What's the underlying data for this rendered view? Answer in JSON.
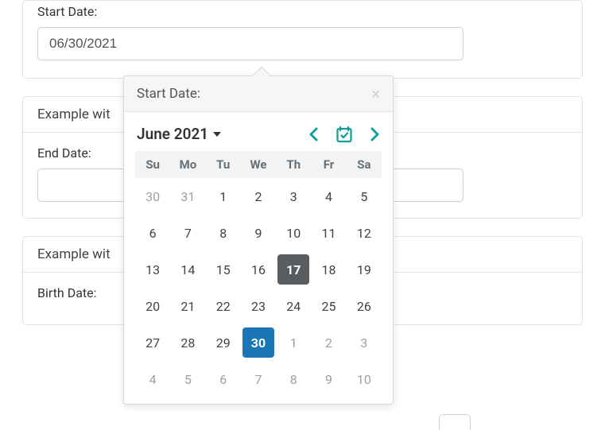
{
  "field1": {
    "label": "Start Date:",
    "value": "06/30/2021"
  },
  "card2": {
    "header": "Example wit",
    "field": {
      "label": "End Date:",
      "value": ""
    }
  },
  "card3": {
    "header": "Example wit",
    "field": {
      "label": "Birth Date:",
      "value": ""
    }
  },
  "datepicker": {
    "title": "Start Date:",
    "month_label": "June 2021",
    "weekdays": [
      "Su",
      "Mo",
      "Tu",
      "We",
      "Th",
      "Fr",
      "Sa"
    ],
    "weeks": [
      [
        {
          "d": "30",
          "muted": true
        },
        {
          "d": "31",
          "muted": true
        },
        {
          "d": "1"
        },
        {
          "d": "2"
        },
        {
          "d": "3"
        },
        {
          "d": "4"
        },
        {
          "d": "5"
        }
      ],
      [
        {
          "d": "6"
        },
        {
          "d": "7"
        },
        {
          "d": "8"
        },
        {
          "d": "9"
        },
        {
          "d": "10"
        },
        {
          "d": "11"
        },
        {
          "d": "12"
        }
      ],
      [
        {
          "d": "13"
        },
        {
          "d": "14"
        },
        {
          "d": "15"
        },
        {
          "d": "16"
        },
        {
          "d": "17",
          "today": true
        },
        {
          "d": "18"
        },
        {
          "d": "19"
        }
      ],
      [
        {
          "d": "20"
        },
        {
          "d": "21"
        },
        {
          "d": "22"
        },
        {
          "d": "23"
        },
        {
          "d": "24"
        },
        {
          "d": "25"
        },
        {
          "d": "26"
        }
      ],
      [
        {
          "d": "27"
        },
        {
          "d": "28"
        },
        {
          "d": "29"
        },
        {
          "d": "30",
          "selected": true
        },
        {
          "d": "1",
          "muted": true
        },
        {
          "d": "2",
          "muted": true
        },
        {
          "d": "3",
          "muted": true
        }
      ],
      [
        {
          "d": "4",
          "muted": true
        },
        {
          "d": "5",
          "muted": true
        },
        {
          "d": "6",
          "muted": true
        },
        {
          "d": "7",
          "muted": true
        },
        {
          "d": "8",
          "muted": true
        },
        {
          "d": "9",
          "muted": true
        },
        {
          "d": "10",
          "muted": true
        }
      ]
    ]
  },
  "colors": {
    "teal": "#12a19a",
    "selected": "#1b76b8",
    "today": "#5a5d60"
  }
}
